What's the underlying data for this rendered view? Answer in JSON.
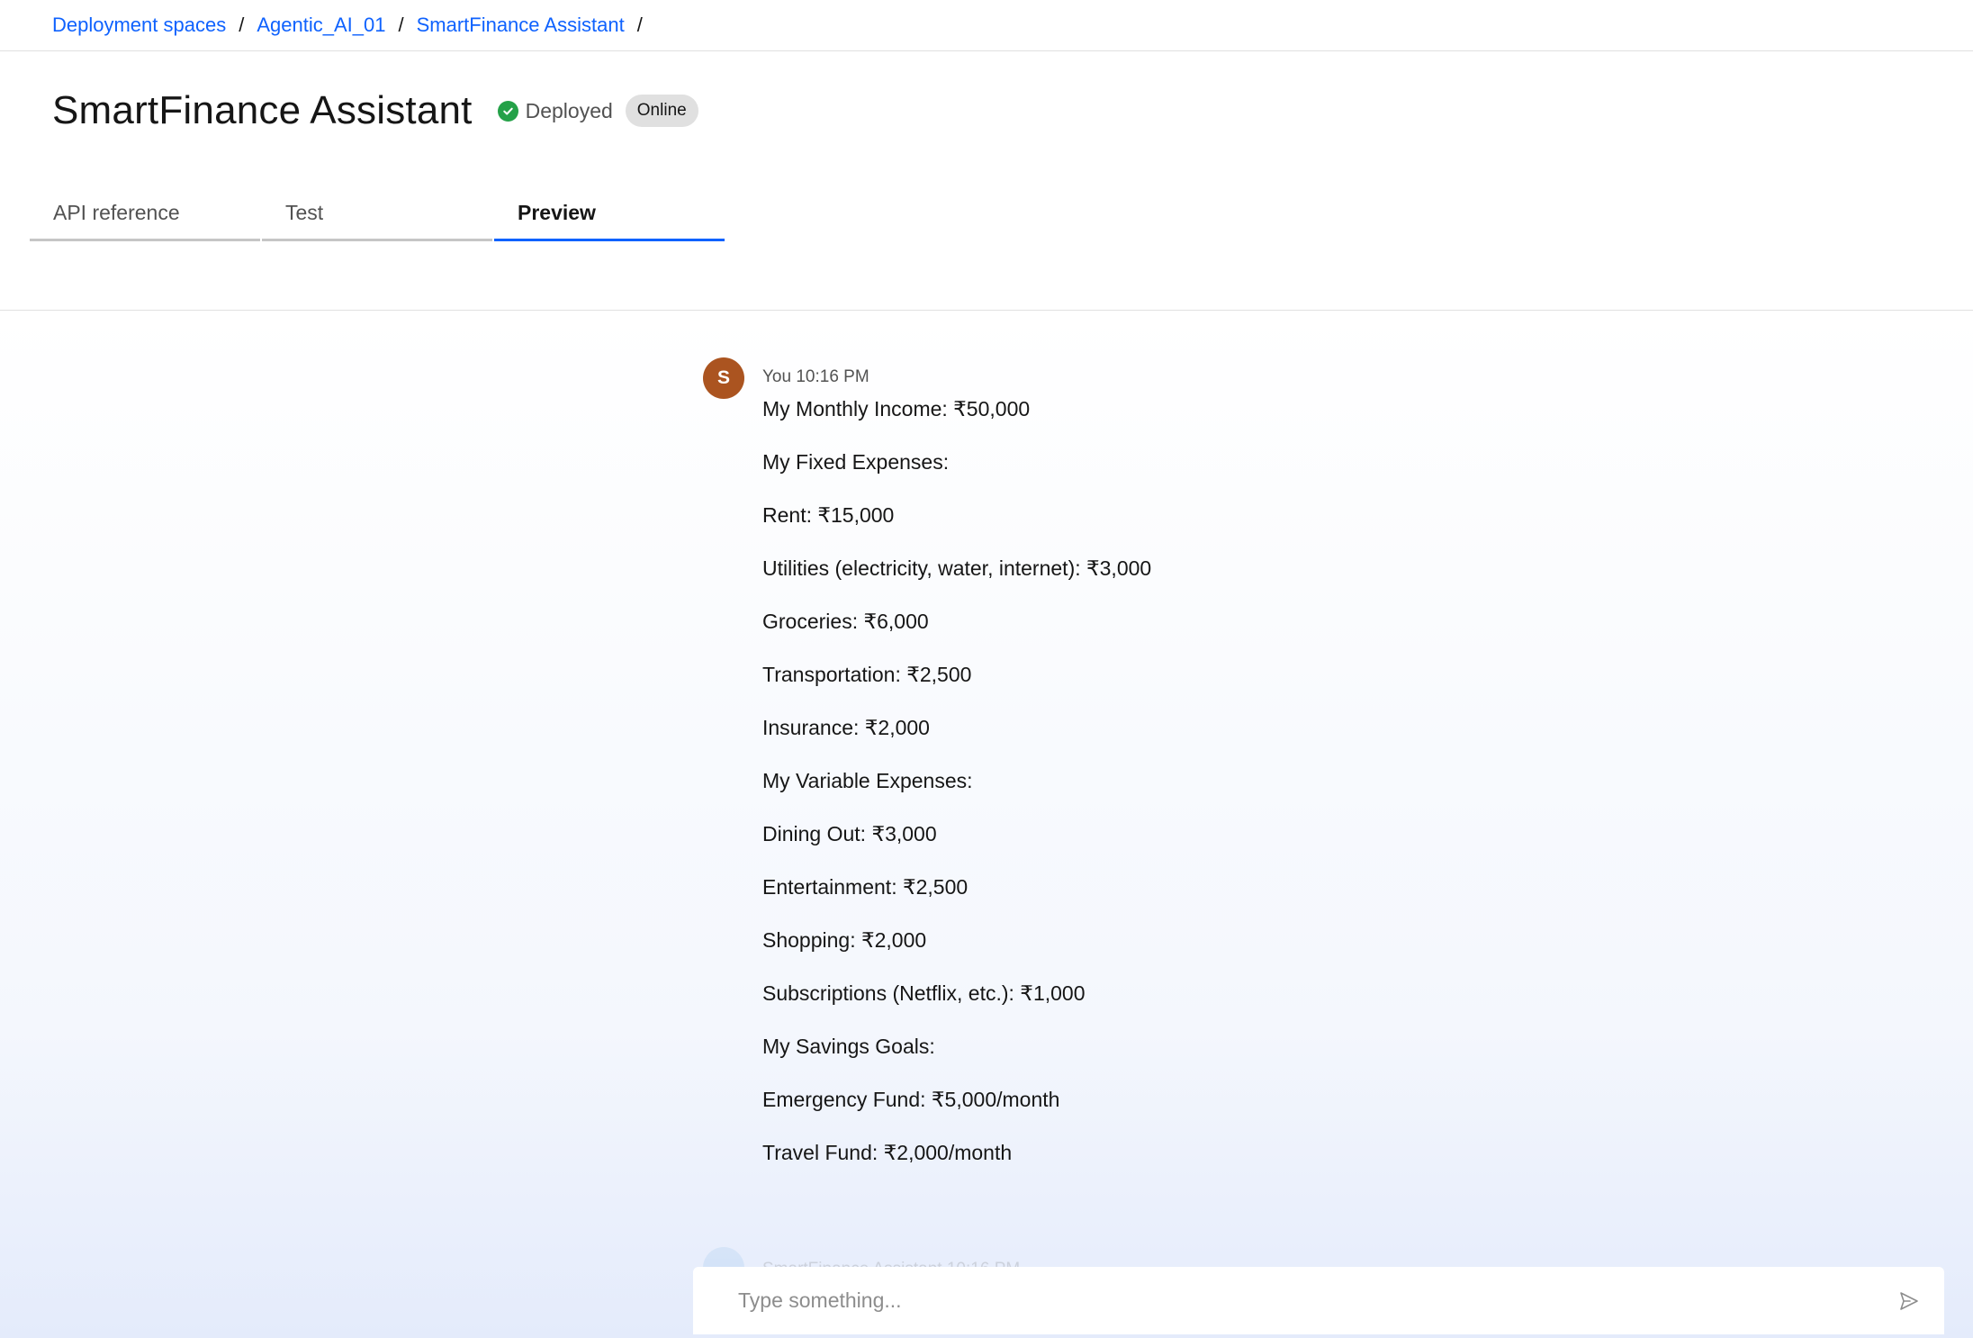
{
  "breadcrumb": {
    "items": [
      "Deployment spaces",
      "Agentic_AI_01",
      "SmartFinance Assistant"
    ],
    "separator": "/"
  },
  "header": {
    "title": "SmartFinance Assistant",
    "status": "Deployed",
    "badge": "Online"
  },
  "tabs": [
    {
      "label": "API reference",
      "active": false
    },
    {
      "label": "Test",
      "active": false
    },
    {
      "label": "Preview",
      "active": true
    }
  ],
  "chat": {
    "message": {
      "avatar_initial": "S",
      "sender": "You",
      "time": "10:16 PM",
      "lines": [
        "My Monthly Income: ₹50,000",
        "My Fixed Expenses:",
        "Rent: ₹15,000",
        "Utilities (electricity, water, internet): ₹3,000",
        "Groceries: ₹6,000",
        "Transportation: ₹2,500",
        "Insurance: ₹2,000",
        "My Variable Expenses:",
        "Dining Out: ₹3,000",
        "Entertainment: ₹2,500",
        "Shopping: ₹2,000",
        "Subscriptions (Netflix, etc.): ₹1,000",
        "My Savings Goals:",
        "Emergency Fund: ₹5,000/month",
        "Travel Fund: ₹2,000/month"
      ]
    },
    "next_message_meta": "SmartFinance Assistant 10:16 PM"
  },
  "input": {
    "placeholder": "Type something...",
    "value": ""
  },
  "colors": {
    "link": "#0f62fe",
    "status_green": "#24a148",
    "avatar": "#ab5420"
  },
  "icons": {
    "status": "checkmark-filled-icon",
    "send": "send-icon"
  }
}
